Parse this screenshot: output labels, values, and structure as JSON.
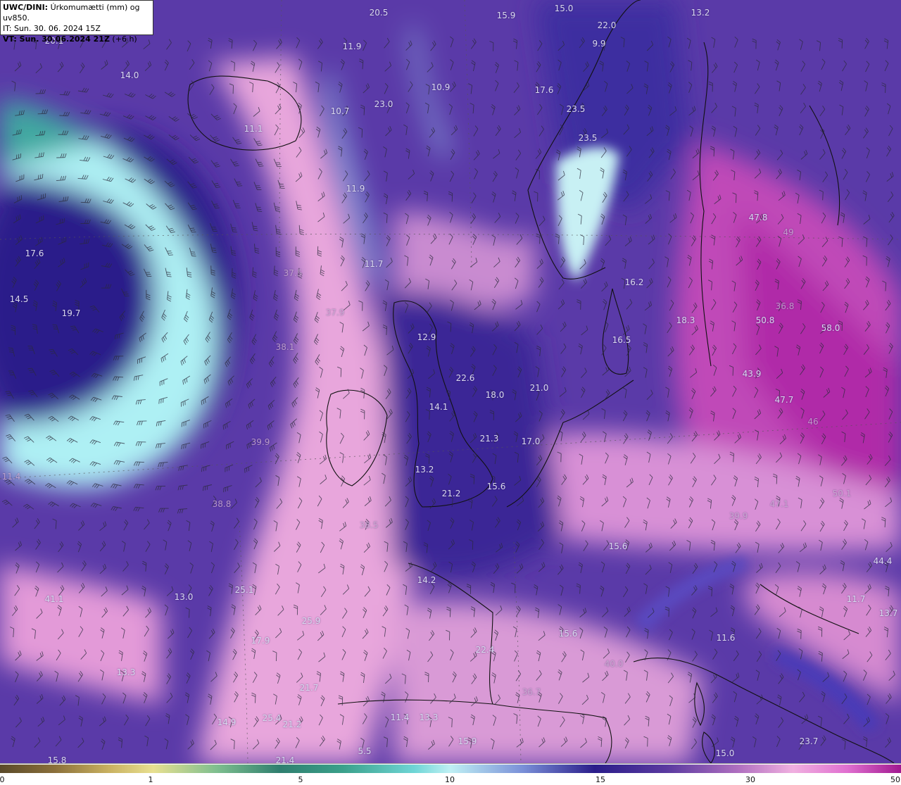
{
  "header": {
    "product": "UWC/DINI:",
    "description": " Úrkomumætti (mm) og uv850.",
    "issue_time": "IT: Sun. 30. 06. 2024 15Z",
    "valid_label": "VT: Sun. 30.06.2024 21Z",
    "valid_offset": " (+6 h)"
  },
  "map_values": [
    {
      "text": "20.5"
    },
    {
      "text": "15.9"
    },
    {
      "text": "15.0"
    },
    {
      "text": "22.0"
    },
    {
      "text": "13.2"
    },
    {
      "text": "20.1"
    },
    {
      "text": "11.9"
    },
    {
      "text": "9.9"
    },
    {
      "text": "14.0"
    },
    {
      "text": "10.9"
    },
    {
      "text": "17.6"
    },
    {
      "text": "10.7"
    },
    {
      "text": "23.0"
    },
    {
      "text": "23.5"
    },
    {
      "text": "11.1"
    },
    {
      "text": "23.5"
    },
    {
      "text": "11.9"
    },
    {
      "text": "47.8"
    },
    {
      "text": "17.6"
    },
    {
      "text": "11.7"
    },
    {
      "text": "14.5"
    },
    {
      "text": "19.7"
    },
    {
      "text": "16.2"
    },
    {
      "text": "18.3"
    },
    {
      "text": "50.8"
    },
    {
      "text": "58.0"
    },
    {
      "text": "12.9"
    },
    {
      "text": "16.5"
    },
    {
      "text": "43.9"
    },
    {
      "text": "22.6"
    },
    {
      "text": "18.0"
    },
    {
      "text": "21.0"
    },
    {
      "text": "47.7"
    },
    {
      "text": "14.1"
    },
    {
      "text": "21.3"
    },
    {
      "text": "17.0"
    },
    {
      "text": "13.2"
    },
    {
      "text": "15.6"
    },
    {
      "text": "21.2"
    },
    {
      "text": "15.6"
    },
    {
      "text": "14.2"
    },
    {
      "text": "41.1"
    },
    {
      "text": "13.0"
    },
    {
      "text": "25.1"
    },
    {
      "text": "25.9"
    },
    {
      "text": "17.9"
    },
    {
      "text": "15.6"
    },
    {
      "text": "22.4"
    },
    {
      "text": "13.3"
    },
    {
      "text": "21.7"
    },
    {
      "text": "14.9"
    },
    {
      "text": "25.4"
    },
    {
      "text": "21.2"
    },
    {
      "text": "11.4"
    },
    {
      "text": "13.3"
    },
    {
      "text": "15.9"
    },
    {
      "text": "15.0"
    },
    {
      "text": "23.7"
    },
    {
      "text": "15.8"
    },
    {
      "text": "21.4"
    },
    {
      "text": "5.5"
    },
    {
      "text": "44.4"
    },
    {
      "text": "13.7"
    },
    {
      "text": "11.7"
    },
    {
      "text": "50.1"
    },
    {
      "text": "47.1"
    },
    {
      "text": "39.9"
    },
    {
      "text": "40.0"
    },
    {
      "text": "11.6"
    },
    {
      "text": "49"
    },
    {
      "text": "36.8"
    },
    {
      "text": "46"
    },
    {
      "text": "37.5"
    },
    {
      "text": "37.9"
    },
    {
      "text": "38.1"
    },
    {
      "text": "39.9"
    },
    {
      "text": "38.8"
    },
    {
      "text": "38.5"
    },
    {
      "text": "11.4"
    },
    {
      "text": "36.7"
    }
  ],
  "colorbar": {
    "ticks": [
      {
        "label": "0",
        "value": 0
      },
      {
        "label": "1",
        "value": 1
      },
      {
        "label": "5",
        "value": 5
      },
      {
        "label": "10",
        "value": 10
      },
      {
        "label": "15",
        "value": 15
      },
      {
        "label": "30",
        "value": 30
      },
      {
        "label": "50",
        "value": 50
      }
    ]
  },
  "colors": {
    "deep_purple": "#2a1d8a",
    "violet": "#6a3ab0",
    "pink": "#e8a6dc",
    "magenta": "#c040b8",
    "cyan": "#aef0f4",
    "teal": "#4fb0b0",
    "coastline": "#111111"
  }
}
